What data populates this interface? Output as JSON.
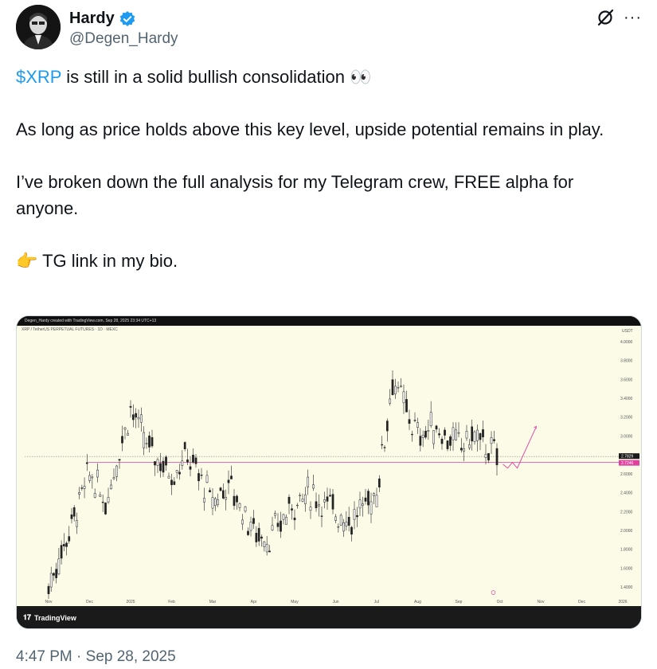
{
  "author": {
    "name": "Hardy",
    "handle": "@Degen_Hardy"
  },
  "tweet": {
    "line1_cashtag": "$XRP",
    "line1_rest": " is still in a solid bullish consolidation 👀",
    "para2": "As long as price holds above this key level, upside potential remains in play.",
    "para3": "I’ve broken down the full analysis for my Telegram crew, FREE alpha for anyone.",
    "para4_icon": "👉",
    "para4": " TG link in my bio."
  },
  "chart": {
    "top_caption": "Degen_Hardy created with TradingView.com, Sep 28, 2025 23:34 UTC+13",
    "pair": "XRP / TetherUS PERPETUAL FUTURES · 1D · MEXC",
    "unit": "USDT",
    "brand": "TradingView",
    "price_label_1": "2.7829",
    "price_label_2": "2.7246",
    "accent_line_color": "#e040a0",
    "up_color": "#ffffff",
    "down_color": "#222222"
  },
  "chart_data": {
    "type": "candlestick",
    "title": "",
    "xlabel": "",
    "ylabel": "USDT",
    "ylim": [
      1.3,
      4.1
    ],
    "yticks": [
      "4.0000",
      "3.8000",
      "3.6000",
      "3.4000",
      "3.2000",
      "3.0000",
      "2.8000",
      "2.6000",
      "2.4000",
      "2.2000",
      "2.0000",
      "1.8000",
      "1.6000",
      "1.4000"
    ],
    "xticks": [
      "Nov",
      "Dec",
      "2025",
      "Feb",
      "Mar",
      "Apr",
      "May",
      "Jun",
      "Jul",
      "Aug",
      "Sep",
      "Oct",
      "Nov",
      "Dec",
      "2026"
    ],
    "key_level": 2.72,
    "current_price": 2.7829,
    "price_path": [
      [
        "Nov",
        1.4
      ],
      [
        "Dec",
        2.6
      ],
      [
        "Dec",
        2.3
      ],
      [
        "2025",
        3.3
      ],
      [
        "2025",
        2.9
      ],
      [
        "Feb",
        2.6
      ],
      [
        "Feb",
        2.8
      ],
      [
        "Mar",
        2.3
      ],
      [
        "Mar",
        2.5
      ],
      [
        "Apr",
        2.0
      ],
      [
        "Apr",
        1.9
      ],
      [
        "May",
        2.3
      ],
      [
        "May",
        2.4
      ],
      [
        "Jun",
        2.2
      ],
      [
        "Jun",
        2.1
      ],
      [
        "Jul",
        2.4
      ],
      [
        "Jul",
        3.6
      ],
      [
        "Aug",
        3.0
      ],
      [
        "Aug",
        3.1
      ],
      [
        "Sep",
        2.9
      ],
      [
        "Sep",
        3.0
      ],
      [
        "Oct",
        2.75
      ]
    ],
    "projection": [
      [
        "Oct",
        2.7
      ],
      [
        "Oct",
        2.66
      ],
      [
        "Oct",
        2.72
      ],
      [
        "Oct",
        2.66
      ],
      [
        "Nov",
        3.1
      ]
    ]
  },
  "timestamp": "4:47 PM · Sep 28, 2025",
  "icons": {
    "verified": "verified-badge-icon",
    "grok": "grok-icon",
    "more": "more-icon"
  }
}
